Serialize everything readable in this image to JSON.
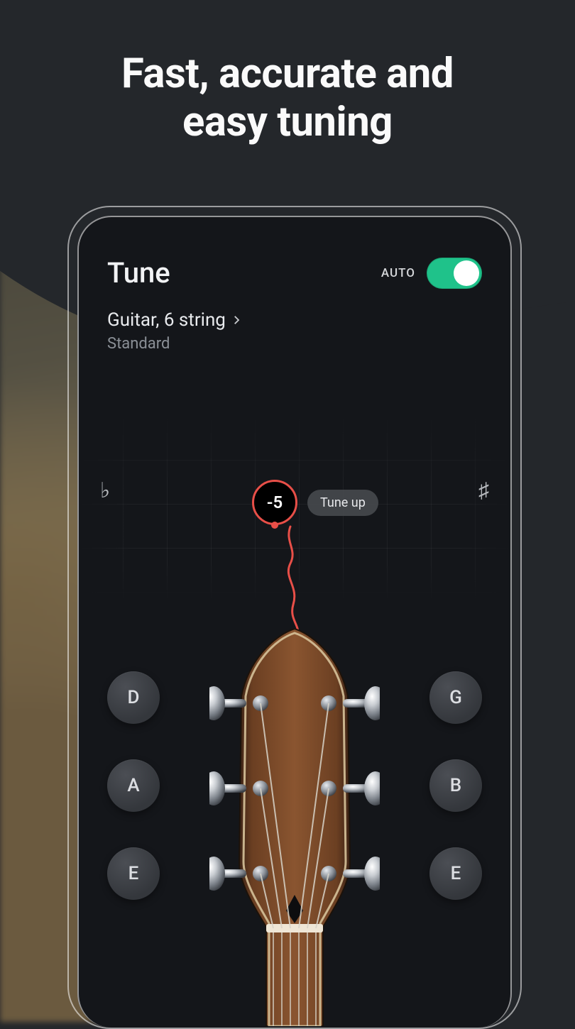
{
  "marketing": {
    "headline_line1": "Fast, accurate and",
    "headline_line2": "easy tuning"
  },
  "header": {
    "title": "Tune",
    "auto_label": "AUTO",
    "auto_on": true
  },
  "instrument": {
    "name": "Guitar, 6 string",
    "tuning": "Standard"
  },
  "tuner": {
    "cents_value": "-5",
    "hint": "Tune up",
    "flat_symbol": "♭",
    "sharp_symbol": "♯",
    "indicator_color": "#e84f48"
  },
  "strings": {
    "left": [
      "D",
      "A",
      "E"
    ],
    "right": [
      "G",
      "B",
      "E"
    ]
  }
}
